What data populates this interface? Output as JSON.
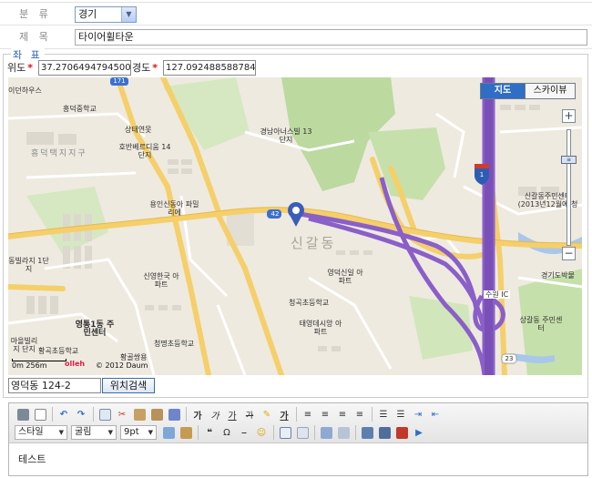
{
  "form": {
    "category": {
      "label": "분 류",
      "value": "경기"
    },
    "title": {
      "label": "제 목",
      "value": "타이어휠타운"
    }
  },
  "coords": {
    "legend": "좌 표",
    "lat_label": "위도",
    "lat_value": "37.27064947945003",
    "lng_label": "경도",
    "lng_value": "127.0924885887847",
    "required_mark": "*"
  },
  "map": {
    "type_buttons": {
      "map": "지도",
      "sky": "스카이뷰"
    },
    "zoom_in": "+",
    "zoom_out": "−",
    "labels": [
      "이던하우스",
      "흥덕중학교",
      "상태연못",
      "호반베르디움 14단지",
      "흥덕택지지구",
      "경남아너스빌 13단지",
      "용인신동아 파밀리에",
      "신갈동",
      "신갈동주민센터 (2013년12월에 청",
      "경기도박물",
      "신영한국 아파트",
      "영덕신일 아파트",
      "청곡초등학교",
      "태영데시앙 아파트",
      "영통1동 주민센터",
      "황곡초등학교",
      "청명초등학교",
      "상갈동 주민센터",
      "동빌라지 1단지",
      "마을빌리지 단지",
      "황골쌍용",
      "수원 IC",
      "42",
      "171",
      "1",
      "23"
    ],
    "scale_text": "0m      256m",
    "copyright": "© 2012 Daum",
    "provider": "olleh"
  },
  "address": {
    "value": "영덕동 124-2",
    "search_button": "위치검색"
  },
  "editor": {
    "style_dropdown": "스타일",
    "font_dropdown": "굴림",
    "size_dropdown": "9pt",
    "format_buttons": [
      "가",
      "가",
      "가",
      "가"
    ],
    "content": "테스트"
  },
  "colors": {
    "map_bg": "#eeeae0",
    "park": "#bcd9a0",
    "major_road": "#f5cf6a",
    "expressway": "#8a5fc8",
    "water": "#a9c7ea",
    "block": "#dcd8ce",
    "accent": "#2f6ec4"
  }
}
